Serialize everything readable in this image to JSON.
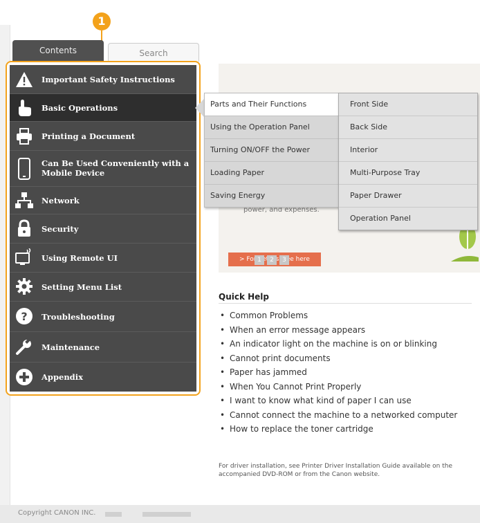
{
  "callout": {
    "number": "1"
  },
  "tabs": {
    "contents": "Contents",
    "search": "Search"
  },
  "nav": [
    {
      "label": "Important Safety Instructions",
      "icon": "warning-icon"
    },
    {
      "label": "Basic Operations",
      "icon": "hand-pointer-icon",
      "active": true
    },
    {
      "label": "Printing a Document",
      "icon": "printer-icon"
    },
    {
      "label": "Can Be Used Conveniently with a Mobile Device",
      "icon": "mobile-device-icon"
    },
    {
      "label": "Network",
      "icon": "network-icon"
    },
    {
      "label": "Security",
      "icon": "lock-icon"
    },
    {
      "label": "Using Remote UI",
      "icon": "remote-ui-icon"
    },
    {
      "label": "Setting Menu List",
      "icon": "gear-icon"
    },
    {
      "label": "Troubleshooting",
      "icon": "question-icon"
    },
    {
      "label": "Maintenance",
      "icon": "wrench-icon"
    },
    {
      "label": "Appendix",
      "icon": "plus-circle-icon"
    }
  ],
  "submenu1": [
    "Parts and Their Functions",
    "Using the Operation Panel",
    "Turning ON/OFF the Power",
    "Loading Paper",
    "Saving Energy"
  ],
  "submenu2": [
    "Front Side",
    "Back Side",
    "Interior",
    "Multi-Purpose Tray",
    "Paper Drawer",
    "Operation Panel"
  ],
  "banner": {
    "text": "power, and expenses.",
    "details": "> For details, see here",
    "pages": [
      "1",
      "2",
      "3"
    ]
  },
  "quick_help": {
    "title": "Quick Help",
    "items": [
      "Common Problems",
      "When an error message appears",
      "An indicator light on the machine is on or blinking",
      "Cannot print documents",
      "Paper has jammed",
      "When You Cannot Print Properly",
      "I want to know what kind of paper I can use",
      "Cannot connect the machine to a networked computer",
      "How to replace the toner cartridge"
    ],
    "note": "For driver installation, see Printer Driver Installation Guide available on the accompanied DVD-ROM or from the Canon website."
  },
  "footer": {
    "copyright": "Copyright CANON INC."
  }
}
